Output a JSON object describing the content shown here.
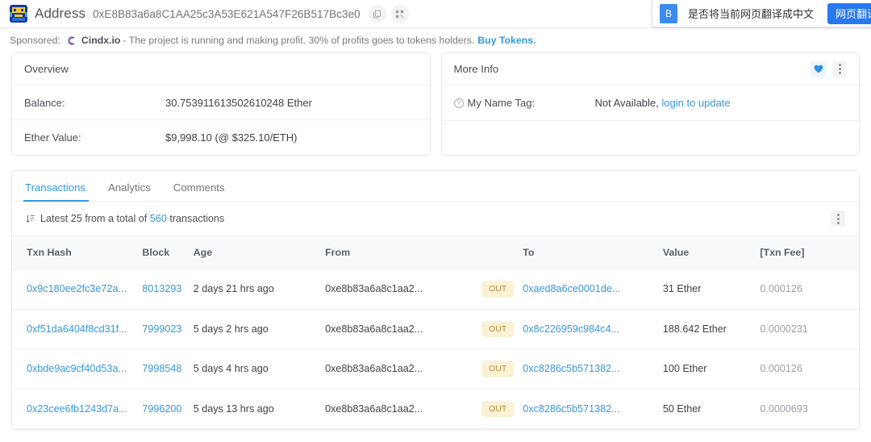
{
  "header": {
    "title": "Address",
    "address": "0xE8B83a6a8C1AA25c3A53E621A547F26B517Bc3e0",
    "copy_icon": "copy-icon",
    "qr_icon": "qr-code-icon"
  },
  "translate_bar": {
    "badge": "B",
    "message": "是否将当前网页翻译成中文",
    "button_label": "网页翻译"
  },
  "sponsored": {
    "label": "Sponsored:",
    "brand": "Cindx.io",
    "text": "- The project is running and making profit. 30% of profits goes to tokens holders.",
    "link": "Buy Tokens."
  },
  "overview": {
    "title": "Overview",
    "rows": [
      {
        "label": "Balance:",
        "value": "30.753911613502610248 Ether"
      },
      {
        "label": "Ether Value:",
        "value": "$9,998.10 (@ $325.10/ETH)"
      }
    ]
  },
  "more_info": {
    "title": "More Info",
    "heart_icon": "heart-icon",
    "kebab_icon": "kebab-menu-icon",
    "name_tag_label": "My Name Tag:",
    "name_tag_value": "Not Available,",
    "name_tag_link": "login to update"
  },
  "tabs": [
    {
      "label": "Transactions",
      "active": true
    },
    {
      "label": "Analytics",
      "active": false
    },
    {
      "label": "Comments",
      "active": false
    }
  ],
  "tx_meta": {
    "sort_icon": "sort-descending-icon",
    "prefix": "Latest 25 from a total of",
    "count": "560",
    "suffix": "transactions",
    "kebab_icon": "kebab-menu-icon"
  },
  "table": {
    "columns": [
      "Txn Hash",
      "Block",
      "Age",
      "From",
      "",
      "To",
      "Value",
      "[Txn Fee]"
    ],
    "rows": [
      {
        "hash": "0x9c180ee2fc3e72a...",
        "block": "8013293",
        "age": "2 days 21 hrs ago",
        "from": "0xe8b83a6a8c1aa2...",
        "direction": "OUT",
        "to": "0xaed8a6ce0001de...",
        "value": "31 Ether",
        "fee": "0.000126"
      },
      {
        "hash": "0xf51da6404f8cd31f...",
        "block": "7999023",
        "age": "5 days 2 hrs ago",
        "from": "0xe8b83a6a8c1aa2...",
        "direction": "OUT",
        "to": "0x8c226959c984c4...",
        "value": "188.642 Ether",
        "fee": "0.0000231"
      },
      {
        "hash": "0xbde9ac9cf40d53a...",
        "block": "7998548",
        "age": "5 days 4 hrs ago",
        "from": "0xe8b83a6a8c1aa2...",
        "direction": "OUT",
        "to": "0xc8286c5b571382...",
        "value": "100 Ether",
        "fee": "0.000126"
      },
      {
        "hash": "0x23cee6fb1243d7a...",
        "block": "7996200",
        "age": "5 days 13 hrs ago",
        "from": "0xe8b83a6a8c1aa2...",
        "direction": "OUT",
        "to": "0xc8286c5b571382...",
        "value": "50 Ether",
        "fee": "0.0000693"
      }
    ]
  },
  "colors": {
    "link": "#3498db",
    "translate_button": "#2878f0",
    "badge_out_bg": "#fbf2d5",
    "badge_out_text": "#b28b36"
  }
}
